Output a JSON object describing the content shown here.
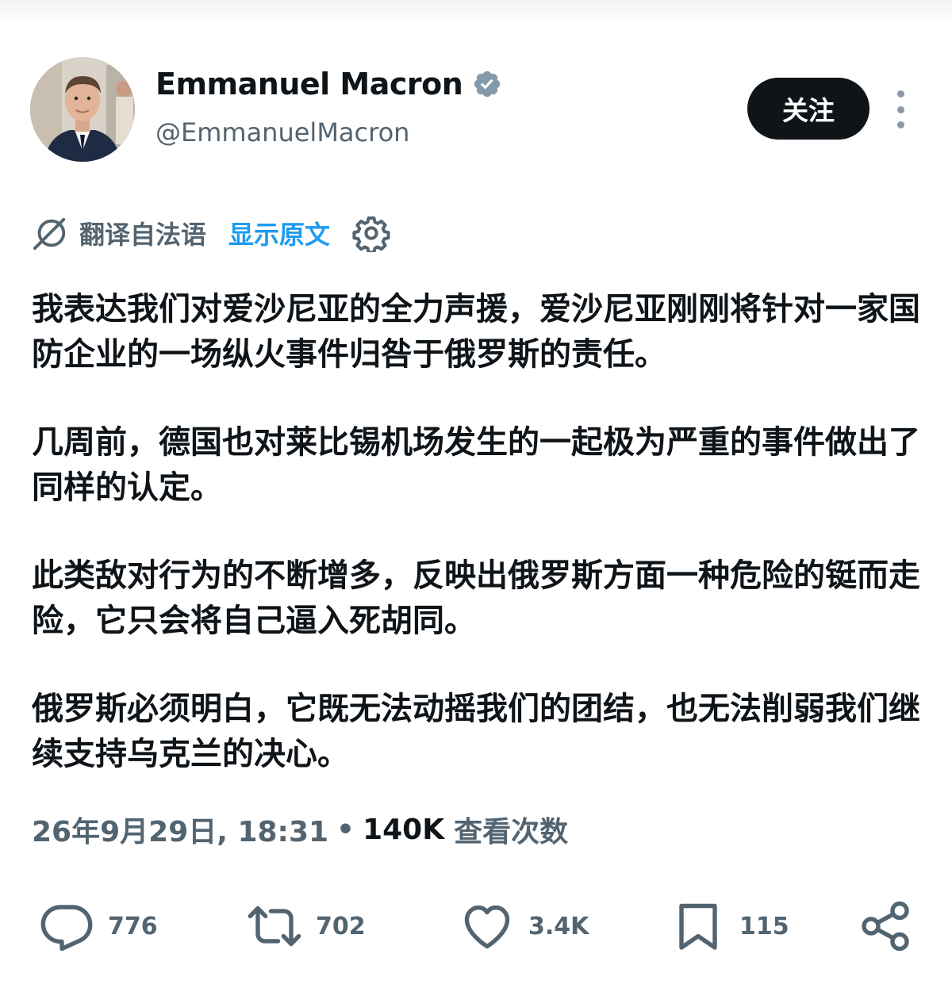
{
  "author": {
    "display_name": "Emmanuel Macron",
    "handle": "@EmmanuelMacron",
    "verified": true,
    "avatar_icon": "profile-photo"
  },
  "follow_label": "关注",
  "translation": {
    "label": "翻译自法语",
    "show_original": "显示原文"
  },
  "post": {
    "paragraphs": [
      "我表达我们对爱沙尼亚的全力声援，爱沙尼亚刚刚将针对一家国防企业的一场纵火事件归咎于俄罗斯的责任。",
      "几周前，德国也对莱比锡机场发生的一起极为严重的事件做出了同样的认定。",
      "此类敌对行为的不断增多，反映出俄罗斯方面一种危险的铤而走险，它只会将自己逼入死胡同。",
      "俄罗斯必须明白，它既无法动摇我们的团结，也无法削弱我们继续支持乌克兰的决心。"
    ]
  },
  "meta": {
    "timestamp": "26年9月29日, 18:31",
    "separator": "•",
    "views_count": "140K",
    "views_label": "查看次数"
  },
  "actions": {
    "replies": "776",
    "reposts": "702",
    "likes": "3.4K",
    "bookmarks": "115"
  },
  "colors": {
    "text": "#0f1419",
    "secondary": "#536471",
    "link": "#1d9bf0",
    "follow_bg": "#0f1419"
  }
}
